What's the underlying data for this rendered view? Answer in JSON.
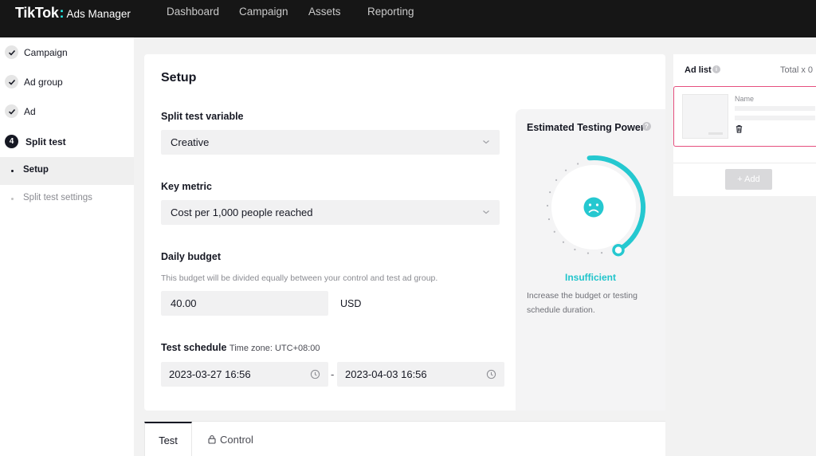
{
  "header": {
    "logo": "TikTok",
    "logo_colon": ":",
    "product": "Ads Manager",
    "nav": [
      "Dashboard",
      "Campaign",
      "Assets",
      "Reporting"
    ]
  },
  "sidebar": {
    "steps": [
      {
        "label": "Campaign",
        "state": "done"
      },
      {
        "label": "Ad group",
        "state": "done"
      },
      {
        "label": "Ad",
        "state": "done"
      },
      {
        "label": "Split test",
        "state": "current",
        "number": "4"
      }
    ],
    "substeps": [
      {
        "label": "Setup",
        "state": "active"
      },
      {
        "label": "Split test settings",
        "state": "inactive"
      }
    ]
  },
  "setup": {
    "title": "Setup",
    "variable_label": "Split test variable",
    "variable_value": "Creative",
    "metric_label": "Key metric",
    "metric_value": "Cost per 1,000 people reached",
    "budget_label": "Daily budget",
    "budget_hint": "This budget will be divided equally between your control and test ad group.",
    "budget_value": "40.00",
    "currency": "USD",
    "schedule_label": "Test schedule",
    "timezone": "Time zone: UTC+08:00",
    "start": "2023-03-27 16:56",
    "separator": "-",
    "end": "2023-04-03 16:56"
  },
  "power": {
    "title": "Estimated Testing Power",
    "help_icon": "?",
    "status": "Insufficient",
    "description": "Increase the budget or testing schedule duration.",
    "level_fraction": 0.45,
    "accent": "#25c8d0"
  },
  "tabs": {
    "test": "Test",
    "control": "Control"
  },
  "adlist": {
    "title": "Ad list",
    "help_icon": "i",
    "total": "Total x 0",
    "name_label": "Name",
    "add_label": "+ Add",
    "border_color": "#e6507f"
  }
}
